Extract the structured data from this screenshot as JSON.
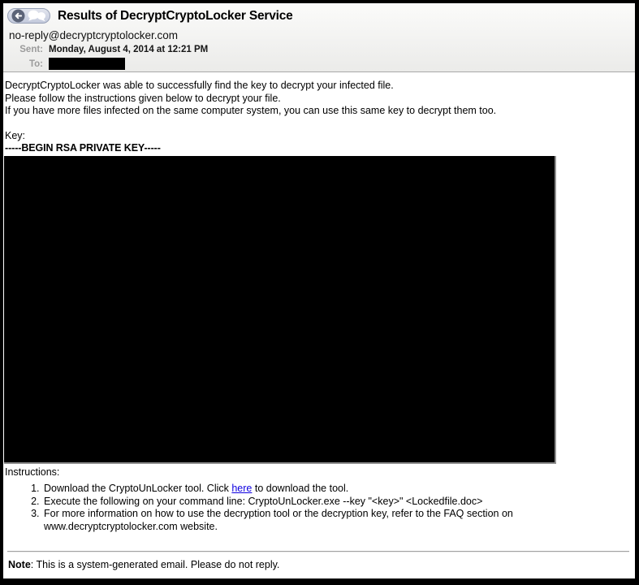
{
  "colors": {
    "link_blue": "#0f00e0",
    "toolbar_circle": "#5c6478",
    "header_divider": "#a9a9a9",
    "redaction_black": "#000000"
  },
  "header": {
    "subject": "Results of DecryptCryptoLocker Service",
    "from": "no-reply@decryptcryptolocker.com",
    "sent_label": "Sent:",
    "sent_value": "Monday, August 4, 2014 at 12:21 PM",
    "to_label": "To:",
    "toolbar_icons": [
      "back-arrow",
      "conversation-bubbles"
    ]
  },
  "email": {
    "intro_lines": [
      "DecryptCryptoLocker was able to successfully find the key to decrypt your infected file.",
      "Please follow the instructions given below to decrypt your file.",
      "If you have more files infected on the same computer system, you can use this same key to decrypt them too."
    ],
    "key_label": "Key:",
    "key_begin_marker": "-----BEGIN RSA PRIVATE KEY-----",
    "instructions_label": "Instructions:",
    "steps": [
      {
        "prefix": "Download the CryptoUnLocker tool. Click ",
        "link": "here",
        "suffix": " to download the tool."
      },
      {
        "text": "Execute the following on your command line: CryptoUnLocker.exe --key \"<key>\" <Lockedfile.doc>"
      },
      {
        "text": "For more information on how to use the decryption tool or the decryption key, refer to the FAQ section on www.decryptcryptolocker.com website."
      }
    ],
    "note_label": "Note",
    "note_text": ": This is a system-generated email. Please do not reply."
  }
}
